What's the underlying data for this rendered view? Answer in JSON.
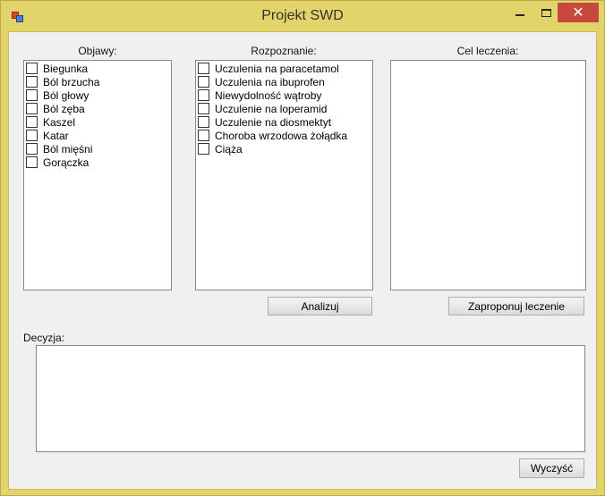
{
  "window": {
    "title": "Projekt SWD"
  },
  "symptoms": {
    "label": "Objawy:",
    "items": [
      "Biegunka",
      "Ból brzucha",
      "Ból głowy",
      "Ból zęba",
      "Kaszel",
      "Katar",
      "Ból mięśni",
      "Gorączka"
    ]
  },
  "diagnosis": {
    "label": "Rozpoznanie:",
    "items": [
      "Uczulenia na paracetamol",
      "Uczulenia na ibuprofen",
      "Niewydolność wątroby",
      "Uczulenie na loperamid",
      "Uczulenie na diosmektyt",
      "Choroba wrzodowa żołądka",
      "Ciąża"
    ]
  },
  "treatment": {
    "label": "Cel leczenia:"
  },
  "buttons": {
    "analyze": "Analizuj",
    "propose": "Zaproponuj leczenie",
    "clear": "Wyczyść"
  },
  "decision": {
    "label": "Decyzja:",
    "value": ""
  }
}
